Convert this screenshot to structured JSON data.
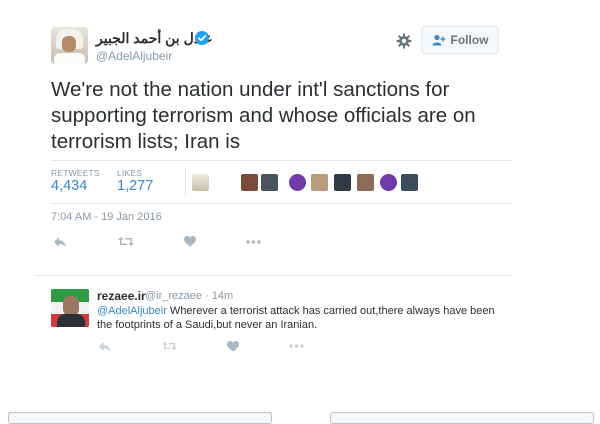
{
  "tweet": {
    "author_name": "عادل بن أحمد الجبير",
    "author_handle": "@AdelAljubeir",
    "follow_label": "Follow",
    "text": "We're not the nation under int'l sanctions for supporting terrorism and whose officials are on terrorism lists; Iran is",
    "stats": {
      "retweets_label": "RETWEETS",
      "retweets_value": "4,434",
      "likes_label": "LIKES",
      "likes_value": "1,277"
    },
    "timestamp": "7:04 AM - 19 Jan 2016",
    "actions": {
      "reply_icon": "reply-icon",
      "retweet_icon": "retweet-icon",
      "like_icon": "heart-icon",
      "more_icon": "more-icon"
    }
  },
  "reply": {
    "author_name": "rezaee.ir",
    "author_handle": "@ir_rezaee",
    "age": "· 14m",
    "mention": "@AdelAljubeir",
    "text": " Wherever a terrorist attack has carried out,there always have been the footprints of a Saudi,but never an Iranian."
  },
  "colors": {
    "link_blue": "#3b88c3",
    "verified_blue": "#1da1f2",
    "muted_gray": "#8899a6",
    "divider": "#e1e8ed"
  }
}
